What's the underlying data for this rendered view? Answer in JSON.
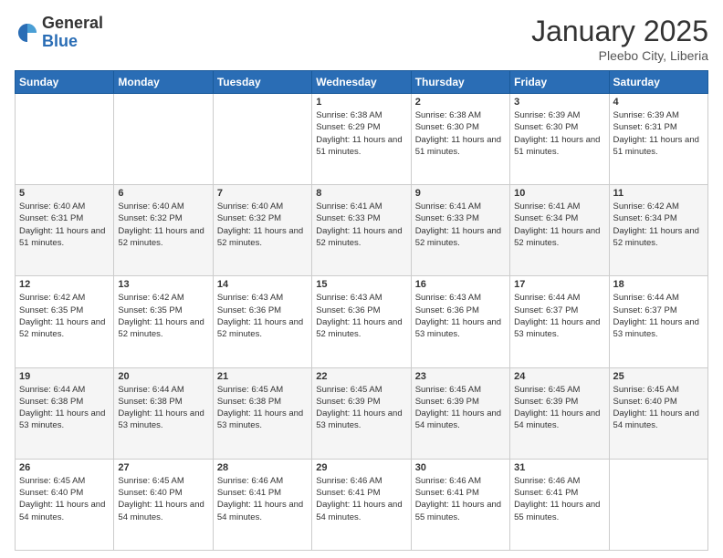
{
  "header": {
    "logo_general": "General",
    "logo_blue": "Blue",
    "month_title": "January 2025",
    "location": "Pleebo City, Liberia"
  },
  "weekdays": [
    "Sunday",
    "Monday",
    "Tuesday",
    "Wednesday",
    "Thursday",
    "Friday",
    "Saturday"
  ],
  "weeks": [
    [
      {
        "day": "",
        "sunrise": "",
        "sunset": "",
        "daylight": ""
      },
      {
        "day": "",
        "sunrise": "",
        "sunset": "",
        "daylight": ""
      },
      {
        "day": "",
        "sunrise": "",
        "sunset": "",
        "daylight": ""
      },
      {
        "day": "1",
        "sunrise": "Sunrise: 6:38 AM",
        "sunset": "Sunset: 6:29 PM",
        "daylight": "Daylight: 11 hours and 51 minutes."
      },
      {
        "day": "2",
        "sunrise": "Sunrise: 6:38 AM",
        "sunset": "Sunset: 6:30 PM",
        "daylight": "Daylight: 11 hours and 51 minutes."
      },
      {
        "day": "3",
        "sunrise": "Sunrise: 6:39 AM",
        "sunset": "Sunset: 6:30 PM",
        "daylight": "Daylight: 11 hours and 51 minutes."
      },
      {
        "day": "4",
        "sunrise": "Sunrise: 6:39 AM",
        "sunset": "Sunset: 6:31 PM",
        "daylight": "Daylight: 11 hours and 51 minutes."
      }
    ],
    [
      {
        "day": "5",
        "sunrise": "Sunrise: 6:40 AM",
        "sunset": "Sunset: 6:31 PM",
        "daylight": "Daylight: 11 hours and 51 minutes."
      },
      {
        "day": "6",
        "sunrise": "Sunrise: 6:40 AM",
        "sunset": "Sunset: 6:32 PM",
        "daylight": "Daylight: 11 hours and 52 minutes."
      },
      {
        "day": "7",
        "sunrise": "Sunrise: 6:40 AM",
        "sunset": "Sunset: 6:32 PM",
        "daylight": "Daylight: 11 hours and 52 minutes."
      },
      {
        "day": "8",
        "sunrise": "Sunrise: 6:41 AM",
        "sunset": "Sunset: 6:33 PM",
        "daylight": "Daylight: 11 hours and 52 minutes."
      },
      {
        "day": "9",
        "sunrise": "Sunrise: 6:41 AM",
        "sunset": "Sunset: 6:33 PM",
        "daylight": "Daylight: 11 hours and 52 minutes."
      },
      {
        "day": "10",
        "sunrise": "Sunrise: 6:41 AM",
        "sunset": "Sunset: 6:34 PM",
        "daylight": "Daylight: 11 hours and 52 minutes."
      },
      {
        "day": "11",
        "sunrise": "Sunrise: 6:42 AM",
        "sunset": "Sunset: 6:34 PM",
        "daylight": "Daylight: 11 hours and 52 minutes."
      }
    ],
    [
      {
        "day": "12",
        "sunrise": "Sunrise: 6:42 AM",
        "sunset": "Sunset: 6:35 PM",
        "daylight": "Daylight: 11 hours and 52 minutes."
      },
      {
        "day": "13",
        "sunrise": "Sunrise: 6:42 AM",
        "sunset": "Sunset: 6:35 PM",
        "daylight": "Daylight: 11 hours and 52 minutes."
      },
      {
        "day": "14",
        "sunrise": "Sunrise: 6:43 AM",
        "sunset": "Sunset: 6:36 PM",
        "daylight": "Daylight: 11 hours and 52 minutes."
      },
      {
        "day": "15",
        "sunrise": "Sunrise: 6:43 AM",
        "sunset": "Sunset: 6:36 PM",
        "daylight": "Daylight: 11 hours and 52 minutes."
      },
      {
        "day": "16",
        "sunrise": "Sunrise: 6:43 AM",
        "sunset": "Sunset: 6:36 PM",
        "daylight": "Daylight: 11 hours and 53 minutes."
      },
      {
        "day": "17",
        "sunrise": "Sunrise: 6:44 AM",
        "sunset": "Sunset: 6:37 PM",
        "daylight": "Daylight: 11 hours and 53 minutes."
      },
      {
        "day": "18",
        "sunrise": "Sunrise: 6:44 AM",
        "sunset": "Sunset: 6:37 PM",
        "daylight": "Daylight: 11 hours and 53 minutes."
      }
    ],
    [
      {
        "day": "19",
        "sunrise": "Sunrise: 6:44 AM",
        "sunset": "Sunset: 6:38 PM",
        "daylight": "Daylight: 11 hours and 53 minutes."
      },
      {
        "day": "20",
        "sunrise": "Sunrise: 6:44 AM",
        "sunset": "Sunset: 6:38 PM",
        "daylight": "Daylight: 11 hours and 53 minutes."
      },
      {
        "day": "21",
        "sunrise": "Sunrise: 6:45 AM",
        "sunset": "Sunset: 6:38 PM",
        "daylight": "Daylight: 11 hours and 53 minutes."
      },
      {
        "day": "22",
        "sunrise": "Sunrise: 6:45 AM",
        "sunset": "Sunset: 6:39 PM",
        "daylight": "Daylight: 11 hours and 53 minutes."
      },
      {
        "day": "23",
        "sunrise": "Sunrise: 6:45 AM",
        "sunset": "Sunset: 6:39 PM",
        "daylight": "Daylight: 11 hours and 54 minutes."
      },
      {
        "day": "24",
        "sunrise": "Sunrise: 6:45 AM",
        "sunset": "Sunset: 6:39 PM",
        "daylight": "Daylight: 11 hours and 54 minutes."
      },
      {
        "day": "25",
        "sunrise": "Sunrise: 6:45 AM",
        "sunset": "Sunset: 6:40 PM",
        "daylight": "Daylight: 11 hours and 54 minutes."
      }
    ],
    [
      {
        "day": "26",
        "sunrise": "Sunrise: 6:45 AM",
        "sunset": "Sunset: 6:40 PM",
        "daylight": "Daylight: 11 hours and 54 minutes."
      },
      {
        "day": "27",
        "sunrise": "Sunrise: 6:45 AM",
        "sunset": "Sunset: 6:40 PM",
        "daylight": "Daylight: 11 hours and 54 minutes."
      },
      {
        "day": "28",
        "sunrise": "Sunrise: 6:46 AM",
        "sunset": "Sunset: 6:41 PM",
        "daylight": "Daylight: 11 hours and 54 minutes."
      },
      {
        "day": "29",
        "sunrise": "Sunrise: 6:46 AM",
        "sunset": "Sunset: 6:41 PM",
        "daylight": "Daylight: 11 hours and 54 minutes."
      },
      {
        "day": "30",
        "sunrise": "Sunrise: 6:46 AM",
        "sunset": "Sunset: 6:41 PM",
        "daylight": "Daylight: 11 hours and 55 minutes."
      },
      {
        "day": "31",
        "sunrise": "Sunrise: 6:46 AM",
        "sunset": "Sunset: 6:41 PM",
        "daylight": "Daylight: 11 hours and 55 minutes."
      },
      {
        "day": "",
        "sunrise": "",
        "sunset": "",
        "daylight": ""
      }
    ]
  ]
}
